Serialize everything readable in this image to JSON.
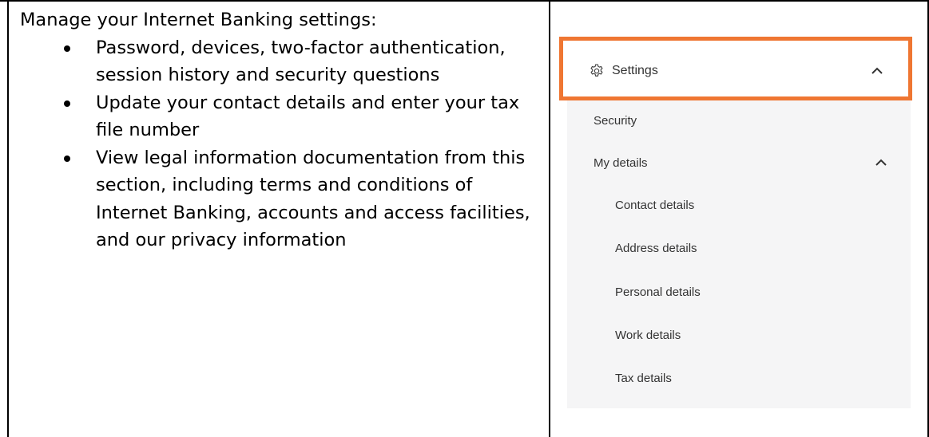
{
  "left": {
    "intro": "Manage your Internet Banking settings:",
    "bullets": [
      "Password, devices, two-factor authentication, session history and security questions",
      "Update your contact details and enter your tax file number",
      "View legal information documentation from this section, including terms and conditions of Internet Banking, accounts and access facilities, and our privacy information"
    ]
  },
  "menu": {
    "settings": {
      "label": "Settings",
      "icon": "gear-icon",
      "expanded": true,
      "highlight_color": "#ef7632"
    },
    "security_label": "Security",
    "my_details": {
      "label": "My details",
      "expanded": true,
      "items": [
        "Contact details",
        "Address details",
        "Personal details",
        "Work details",
        "Tax details"
      ]
    },
    "background": "#f5f5f6"
  }
}
